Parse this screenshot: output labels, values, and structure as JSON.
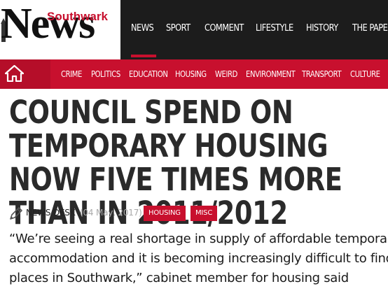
{
  "site": {
    "logo_sub": "Southwark",
    "logo_main": "News"
  },
  "main_nav": {
    "items": [
      {
        "label": "NEWS",
        "active": true
      },
      {
        "label": "SPORT",
        "active": false
      },
      {
        "label": "COMMENT",
        "active": false
      },
      {
        "label": "LIFESTYLE",
        "active": false
      },
      {
        "label": "HISTORY",
        "active": false
      },
      {
        "label": "THE PAPER",
        "active": false
      }
    ]
  },
  "sub_nav": {
    "home_icon": "home-icon",
    "items": [
      {
        "label": "CRIME"
      },
      {
        "label": "POLITICS"
      },
      {
        "label": "EDUCATION"
      },
      {
        "label": "HOUSING"
      },
      {
        "label": "WEIRD"
      },
      {
        "label": "ENVIRONMENT"
      },
      {
        "label": "TRANSPORT"
      },
      {
        "label": "CULTURE"
      }
    ]
  },
  "article": {
    "headline": "COUNCIL SPEND ON TEMPORARY HOUSING NOW FIVE TIMES MORE THAN IN 2011/2012",
    "author": "NEWS DESK",
    "date": "(04 May, 2017)",
    "tags": [
      {
        "label": "HOUSING"
      },
      {
        "label": "MISC"
      }
    ],
    "body": "“We’re seeing a real shortage in supply of affordable temporary accommodation and it is becoming increasingly difficult to find places in Southwark,” cabinet member for housing said"
  },
  "colors": {
    "brand_red": "#c8102e",
    "nav_dark": "#1c1c1c"
  }
}
